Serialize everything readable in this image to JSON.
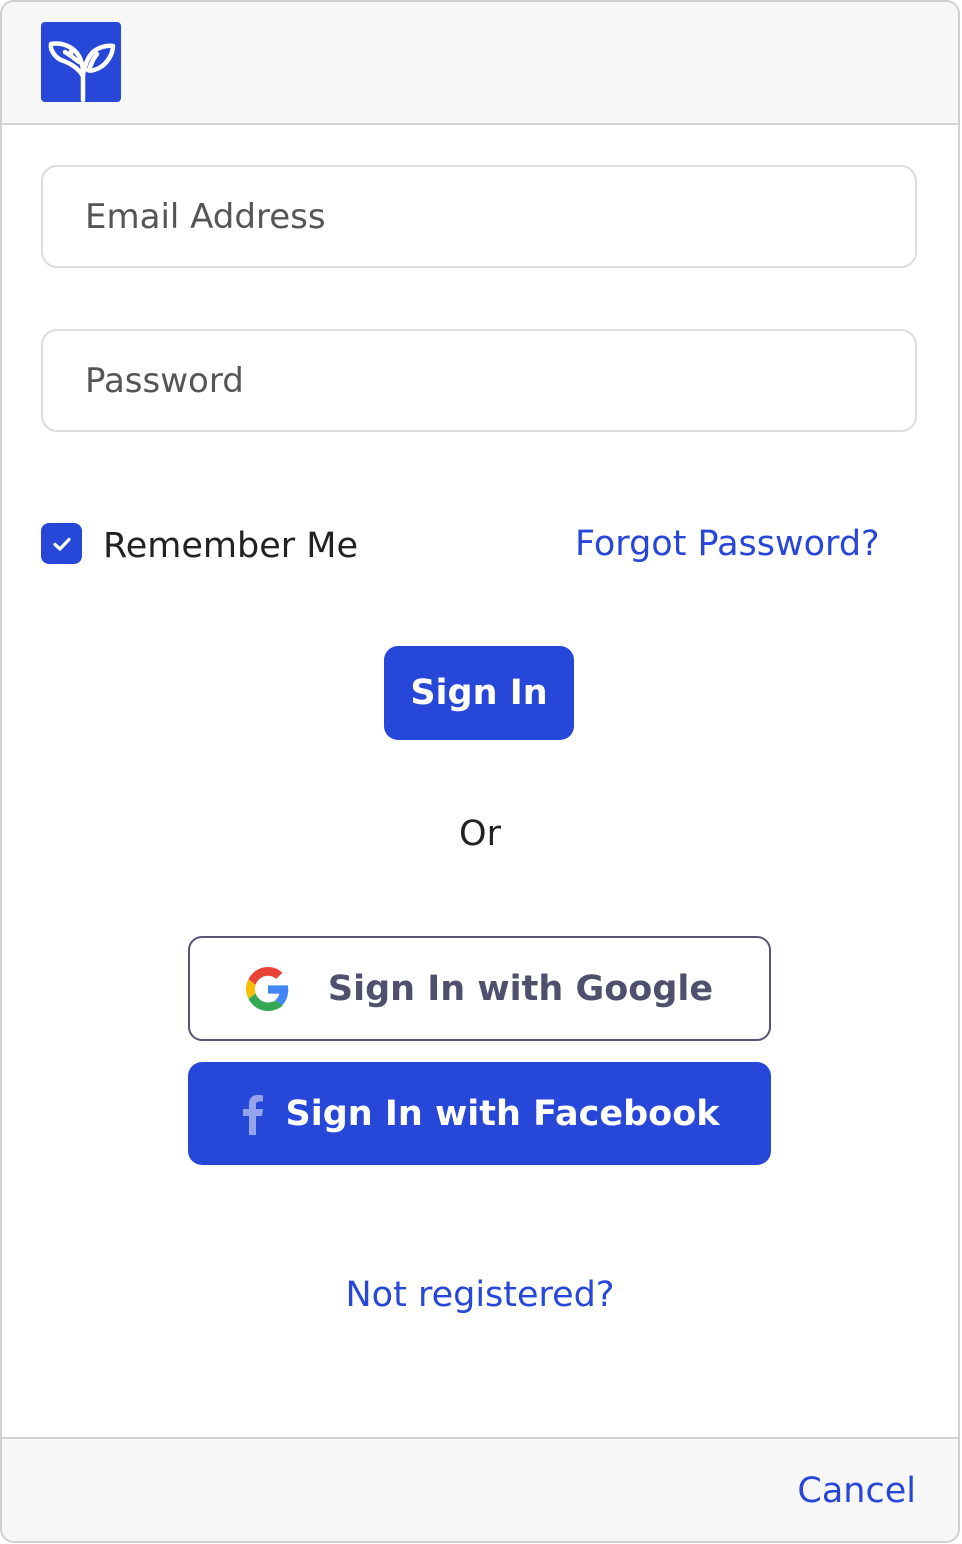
{
  "header": {
    "logo_icon": "sprout-icon"
  },
  "form": {
    "email_placeholder": "Email Address",
    "password_placeholder": "Password",
    "remember_me_label": "Remember Me",
    "remember_me_checked": true,
    "forgot_password": "Forgot Password?",
    "sign_in": "Sign In",
    "or": "Or",
    "google": "Sign In with Google",
    "facebook": "Sign In with Facebook",
    "not_registered": "Not registered?"
  },
  "footer": {
    "cancel": "Cancel"
  },
  "colors": {
    "accent": "#2747d8"
  }
}
